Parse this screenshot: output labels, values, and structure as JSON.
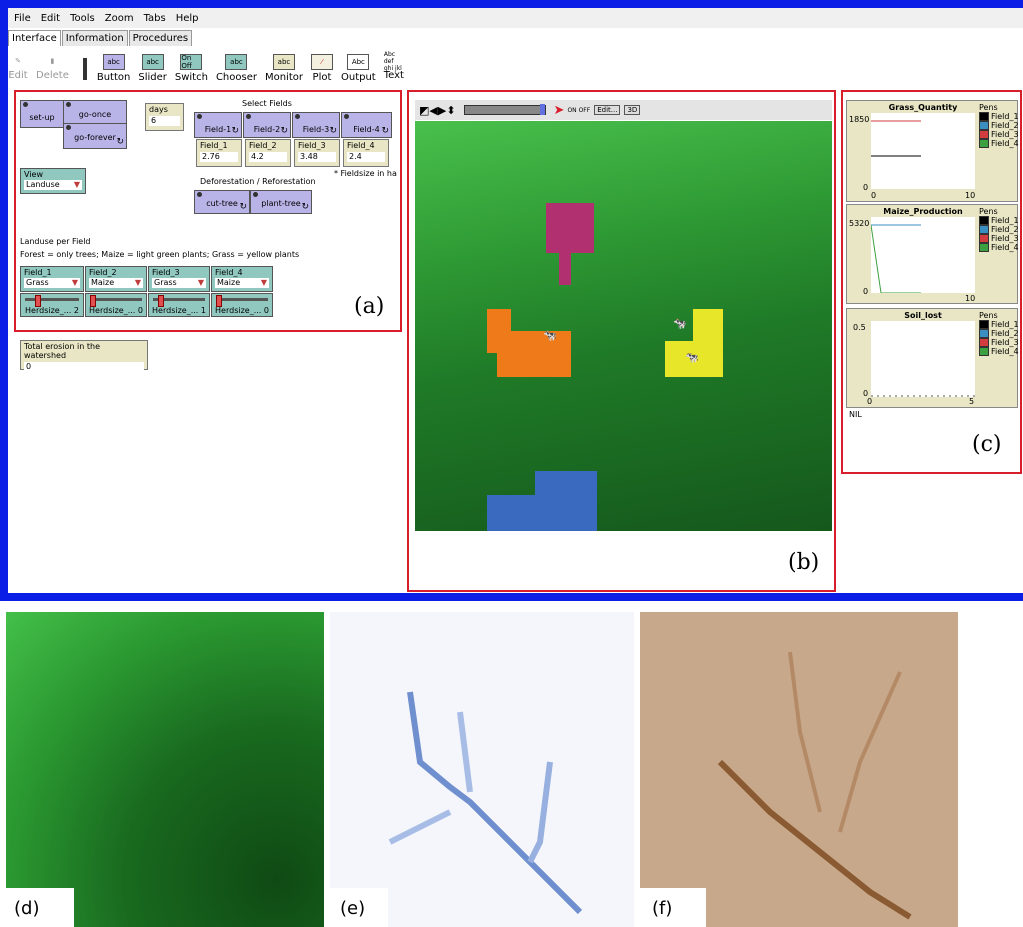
{
  "menu": [
    "File",
    "Edit",
    "Tools",
    "Zoom",
    "Tabs",
    "Help"
  ],
  "tabs": [
    "Interface",
    "Information",
    "Procedures"
  ],
  "toolbar": [
    "Edit",
    "Delete",
    "Button",
    "Slider",
    "Switch",
    "Chooser",
    "Monitor",
    "Plot",
    "Output",
    "Text"
  ],
  "toolbar_icon_text": {
    "button": "abc",
    "slider": "abc",
    "chooser": "abc",
    "monitor": "abc",
    "output": "Abc",
    "text": "Abc def ghi jkl",
    "switch": "On Off"
  },
  "panel_a": {
    "buttons": {
      "setup": "set-up",
      "goonce": "go-once",
      "goforever": "go-forever",
      "cuttree": "cut-tree",
      "planttree": "plant-tree"
    },
    "days": {
      "label": "days",
      "value": "6"
    },
    "select_fields_title": "Select Fields",
    "field_buttons": [
      "Field-1",
      "Field-2",
      "Field-3",
      "Field-4"
    ],
    "field_monitors": [
      {
        "label": "Field_1",
        "value": "2.76"
      },
      {
        "label": "Field_2",
        "value": "4.2"
      },
      {
        "label": "Field_3",
        "value": "3.48"
      },
      {
        "label": "Field_4",
        "value": "2.4"
      }
    ],
    "fieldsize_note": "* Fieldsize in ha",
    "defo_title": "Deforestation / Reforestation",
    "view_chooser": {
      "label": "View",
      "value": "Landuse"
    },
    "landuse_title": "Landuse per Field",
    "landuse_legend": "Forest = only trees; Maize = light green plants; Grass = yellow plants",
    "landuse_choosers": [
      {
        "label": "Field_1",
        "value": "Grass"
      },
      {
        "label": "Field_2",
        "value": "Maize"
      },
      {
        "label": "Field_3",
        "value": "Grass"
      },
      {
        "label": "Field_4",
        "value": "Maize"
      }
    ],
    "herd_sliders": [
      "Herdsize_... 2",
      "Herdsize_... 0",
      "Herdsize_... 1",
      "Herdsize_... 0"
    ],
    "herd_values": [
      2,
      0,
      1,
      0
    ],
    "marker": "(a)"
  },
  "erosion": {
    "label": "Total erosion in the watershed",
    "value": "0"
  },
  "panel_b": {
    "marker": "(b)",
    "edit_label": "Edit...",
    "three_d": "3D",
    "switch_text": "ON OFF"
  },
  "panel_c": {
    "marker": "(c)",
    "plots": [
      {
        "title": "Grass_Quantity",
        "ymax": "1850",
        "ymin": "0",
        "xmin": "0",
        "xmax": "10",
        "pens_label": "Pens",
        "pens": [
          "Field_1",
          "Field_2",
          "Field_3",
          "Field_4"
        ]
      },
      {
        "title": "Maize_Production",
        "ymax": "5320",
        "ymin": "0",
        "xmin": "0",
        "xmax": "10",
        "pens_label": "Pens",
        "pens": [
          "Field_1",
          "Field_2",
          "Field_3",
          "Field_4"
        ]
      },
      {
        "title": "Soil_lost",
        "ymax": "0.5",
        "ymin": "0",
        "xmin": "0",
        "xmax": "5",
        "pens_label": "Pens",
        "pens": [
          "Field_1",
          "Field_2",
          "Field_3",
          "Field_4"
        ]
      }
    ],
    "nil": "NIL"
  },
  "pen_colors": [
    "#000000",
    "#3a8fc0",
    "#d23c3c",
    "#3ca040"
  ],
  "bottom_labels": [
    "(d)",
    "(e)",
    "(f)"
  ]
}
